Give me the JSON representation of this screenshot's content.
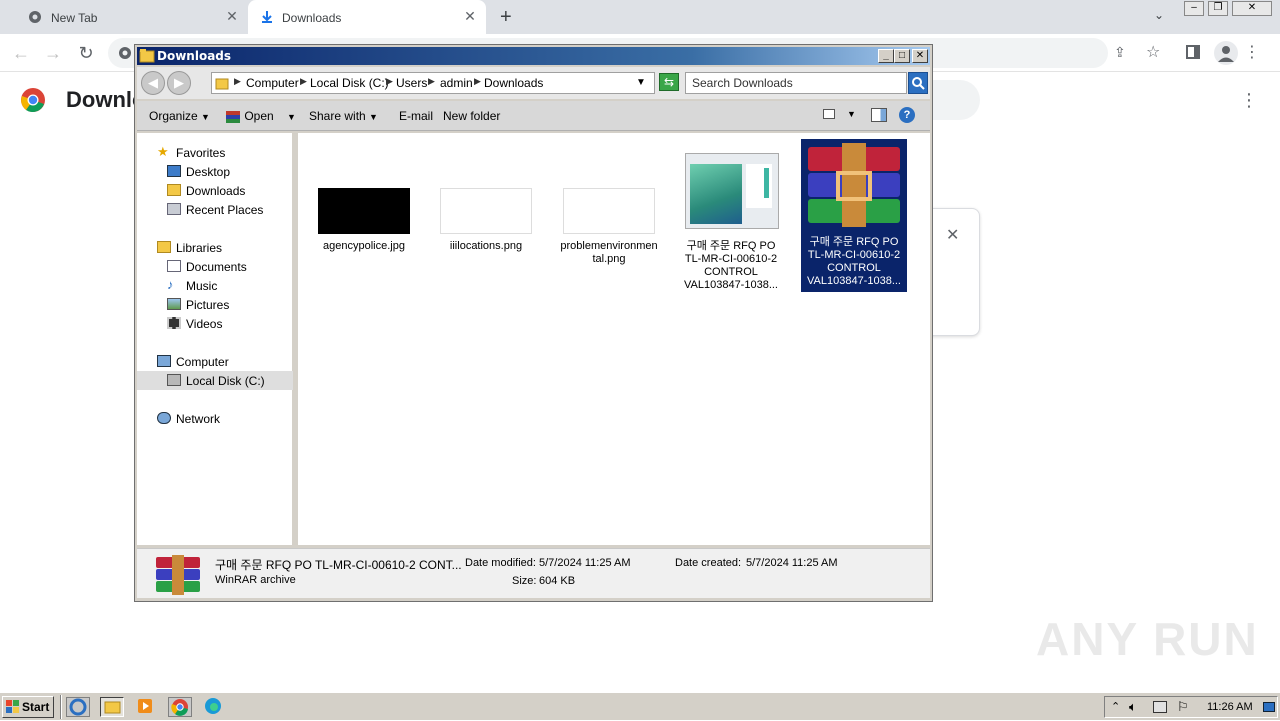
{
  "browser": {
    "tabs": [
      {
        "label": "New Tab"
      },
      {
        "label": "Downloads"
      }
    ],
    "page_title": "Downlo"
  },
  "explorer": {
    "title": "Downloads",
    "breadcrumb": [
      "Computer",
      "Local Disk (C:)",
      "Users",
      "admin",
      "Downloads"
    ],
    "search_placeholder": "Search Downloads",
    "commands": {
      "organize": "Organize",
      "open": "Open",
      "share_with": "Share with",
      "email": "E-mail",
      "new_folder": "New folder"
    },
    "nav": {
      "favorites": "Favorites",
      "desktop": "Desktop",
      "downloads": "Downloads",
      "recent_places": "Recent Places",
      "libraries": "Libraries",
      "documents": "Documents",
      "music": "Music",
      "pictures": "Pictures",
      "videos": "Videos",
      "computer": "Computer",
      "local_disk": "Local Disk (C:)",
      "network": "Network"
    },
    "files": [
      {
        "name_lines": [
          "agencypolice.jpg"
        ]
      },
      {
        "name_lines": [
          "iiilocations.png"
        ]
      },
      {
        "name_lines": [
          "problemenvironmen",
          "tal.png"
        ]
      },
      {
        "name_lines": [
          "구매 주문 RFQ PO",
          "TL-MR-CI-00610-2",
          "CONTROL",
          "VAL103847-1038..."
        ]
      },
      {
        "name_lines": [
          "구매 주문 RFQ PO",
          "TL-MR-CI-00610-2",
          "CONTROL",
          "VAL103847-1038..."
        ]
      }
    ],
    "details": {
      "name": "구매 주문 RFQ PO TL-MR-CI-00610-2 CONT...",
      "type": "WinRAR archive",
      "date_modified_label": "Date modified:",
      "date_modified": "5/7/2024 11:25 AM",
      "size_label": "Size:",
      "size": "604 KB",
      "date_created_label": "Date created:",
      "date_created": "5/7/2024 11:25 AM"
    }
  },
  "taskbar": {
    "start": "Start",
    "clock": "11:26 AM"
  },
  "watermark": "ANY RUN"
}
